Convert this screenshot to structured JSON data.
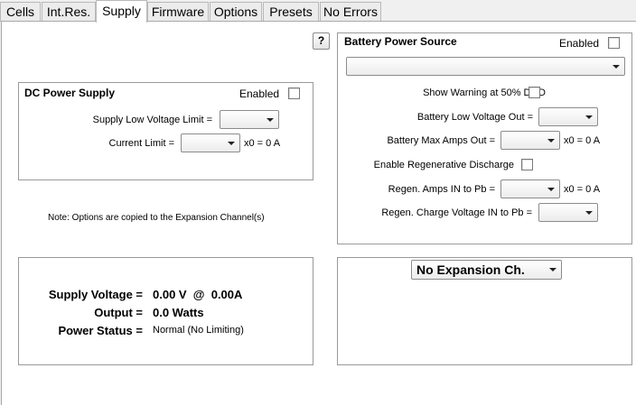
{
  "tabs": [
    "Cells",
    "Int.Res.",
    "Supply",
    "Firmware",
    "Options",
    "Presets",
    "No Errors"
  ],
  "active_tab": "Supply",
  "help_button": "?",
  "dc_power_supply": {
    "title": "DC Power Supply",
    "enabled_label": "Enabled",
    "enabled": false,
    "low_voltage_label": "Supply Low Voltage Limit =",
    "current_limit_label": "Current Limit =",
    "current_limit_suffix": "x0 = 0 A"
  },
  "note": "Note:  Options are copied to the Expansion Channel(s)",
  "battery": {
    "title": "Battery Power Source",
    "enabled_label": "Enabled",
    "enabled": false,
    "show_warning_label": "Show Warning at 50% DOD",
    "low_voltage_out_label": "Battery Low Voltage Out =",
    "max_amps_out_label": "Battery Max Amps Out =",
    "max_amps_suffix": "x0 = 0 A",
    "regen_discharge_label": "Enable Regenerative Discharge",
    "regen_amps_label": "Regen. Amps IN to Pb =",
    "regen_amps_suffix": "x0 = 0 A",
    "regen_charge_label": "Regen. Charge Voltage IN to Pb ="
  },
  "status": {
    "supply_voltage_label": "Supply Voltage =",
    "supply_voltage_value": "0.00 V  @  0.00A",
    "output_label": "Output =",
    "output_value": "0.0 Watts",
    "power_status_label": "Power Status =",
    "power_status_value": "Normal (No Limiting)"
  },
  "expansion": {
    "selected": "No Expansion Ch."
  }
}
